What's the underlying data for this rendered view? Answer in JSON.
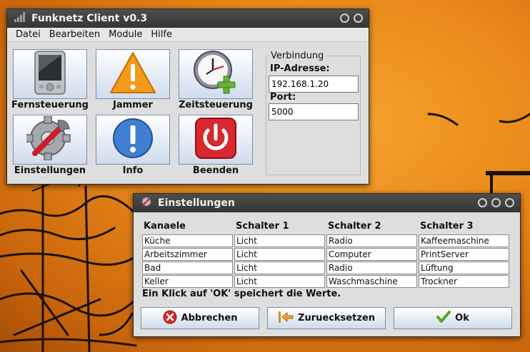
{
  "main_window": {
    "title": "Funknetz Client v0.3",
    "menu": [
      "Datei",
      "Bearbeiten",
      "Module",
      "Hilfe"
    ],
    "tiles": [
      {
        "label": "Fernsteuerung",
        "icon": "pda-icon"
      },
      {
        "label": "Jammer",
        "icon": "warning-icon"
      },
      {
        "label": "Zeitsteuerung",
        "icon": "clock-add-icon"
      },
      {
        "label": "Einstellungen",
        "icon": "settings-gear-icon"
      },
      {
        "label": "Info",
        "icon": "info-icon"
      },
      {
        "label": "Beenden",
        "icon": "power-icon"
      }
    ],
    "connection": {
      "legend": "Verbindung",
      "ip_label": "IP-Adresse:",
      "ip_value": "192.168.1.20",
      "port_label": "Port:",
      "port_value": "5000"
    }
  },
  "settings_dialog": {
    "title": "Einstellungen",
    "columns": [
      "Kanaele",
      "Schalter 1",
      "Schalter 2",
      "Schalter 3"
    ],
    "rows": [
      [
        "Küche",
        "Licht",
        "Radio",
        "Kaffeemaschine"
      ],
      [
        "Arbeitszimmer",
        "Licht",
        "Computer",
        "PrintServer"
      ],
      [
        "Bad",
        "Licht",
        "Radio",
        "Lüftung"
      ],
      [
        "Keller",
        "Licht",
        "Waschmaschine",
        "Trockner"
      ]
    ],
    "hint": "Ein Klick auf 'OK' speichert die Werte.",
    "buttons": {
      "cancel": "Abbrechen",
      "reset": "Zuruecksetzen",
      "ok": "Ok"
    }
  },
  "colors": {
    "desktop": "#e98a1a",
    "titlebar": "#3f3f3f",
    "window_bg": "#dedede",
    "button_gradient_end": "#cfdcec"
  }
}
